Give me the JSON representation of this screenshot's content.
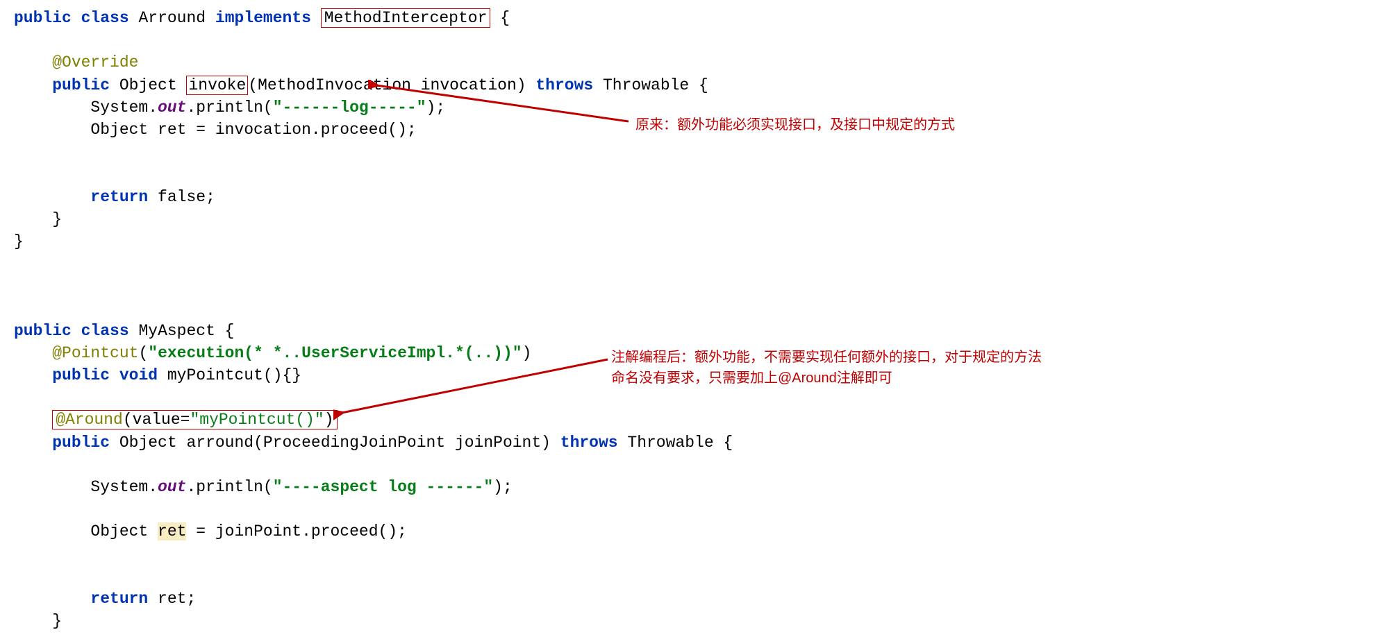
{
  "block1": {
    "l1_kw1": "public",
    "l1_kw2": "class",
    "l1_class": "Arround",
    "l1_kw3": "implements",
    "l1_iface": "MethodInterceptor",
    "l1_brace": " {",
    "l2_anno": "@Override",
    "l3_kw1": "public",
    "l3_type": " Object ",
    "l3_method": "invoke",
    "l3_params": "(MethodInvocation invocation) ",
    "l3_kw2": "throws",
    "l3_throws": " Throwable {",
    "l4_pre": "        System.",
    "l4_out": "out",
    "l4_mid": ".println(",
    "l4_str": "\"------log-----\"",
    "l4_post": ");",
    "l5": "        Object ret = invocation.proceed();",
    "l6_kw": "return",
    "l6_val": " false;",
    "l7": "    }",
    "l8": "}"
  },
  "block2": {
    "l1_kw1": "public",
    "l1_kw2": "class",
    "l1_class": " MyAspect {",
    "l2_anno": "@Pointcut",
    "l2_paren": "(",
    "l2_str": "\"execution(* *..UserServiceImpl.*(..))\"",
    "l2_close": ")",
    "l3_kw1": "public",
    "l3_kw2": "void",
    "l3_rest": " myPointcut(){}",
    "l4_anno": "@Around",
    "l4_paren": "(value=",
    "l4_str": "\"myPointcut()\"",
    "l4_close": ")",
    "l5_kw1": "public",
    "l5_mid": " Object arround(ProceedingJoinPoint joinPoint) ",
    "l5_kw2": "throws",
    "l5_rest": " Throwable {",
    "l6_pre": "        System.",
    "l6_out": "out",
    "l6_mid": ".println(",
    "l6_str": "\"----aspect log ------\"",
    "l6_post": ");",
    "l7_pre": "        Object ",
    "l7_ret": "ret",
    "l7_post": " = joinPoint.proceed();",
    "l8_kw": "return",
    "l8_rest": " ret;",
    "l9": "    }"
  },
  "annotations": {
    "top": "原来：额外功能必须实现接口，及接口中规定的方式",
    "bottom_l1": "注解编程后：额外功能，不需要实现任何额外的接口，对于规定的方法",
    "bottom_l2": "命名没有要求，只需要加上@Around注解即可"
  }
}
